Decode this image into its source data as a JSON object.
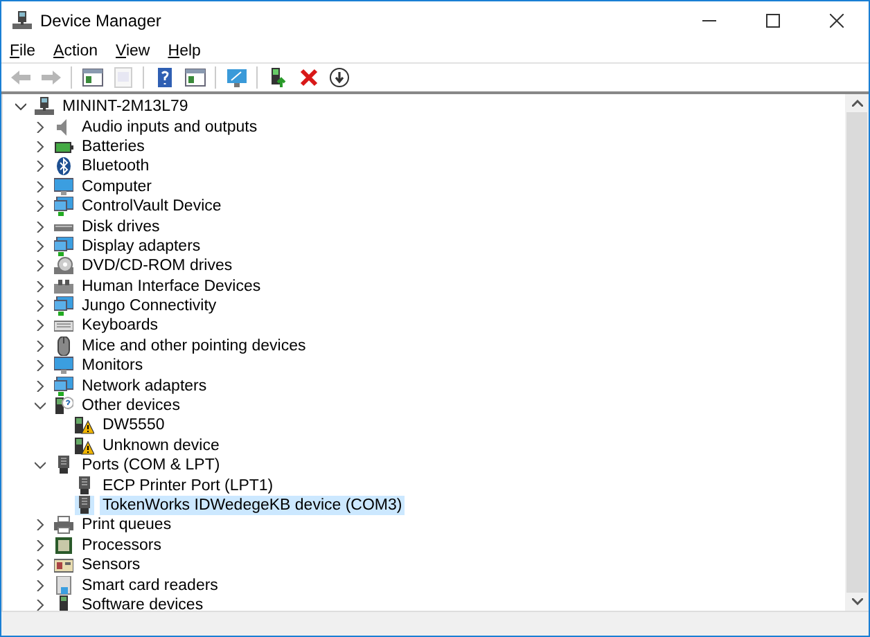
{
  "window": {
    "title": "Device Manager"
  },
  "menu": [
    "File",
    "Action",
    "View",
    "Help"
  ],
  "toolbar": [
    {
      "disabled": true
    },
    {
      "disabled": true
    },
    {
      "disabled": false
    },
    {
      "disabled": true
    },
    {
      "disabled": false
    },
    {
      "disabled": false
    },
    {
      "disabled": false
    },
    {
      "disabled": false
    },
    {
      "disabled": false
    },
    {
      "disabled": false
    }
  ],
  "tree": {
    "label": "MININT-2M13L79",
    "expanded": true,
    "selected": false,
    "children": [
      {
        "label": "Audio inputs and outputs",
        "expanded": false,
        "selected": false
      },
      {
        "label": "Batteries",
        "expanded": false,
        "selected": false
      },
      {
        "label": "Bluetooth",
        "expanded": false,
        "selected": false
      },
      {
        "label": "Computer",
        "expanded": false,
        "selected": false
      },
      {
        "label": "ControlVault Device",
        "expanded": false,
        "selected": false
      },
      {
        "label": "Disk drives",
        "expanded": false,
        "selected": false
      },
      {
        "label": "Display adapters",
        "expanded": false,
        "selected": false
      },
      {
        "label": "DVD/CD-ROM drives",
        "expanded": false,
        "selected": false
      },
      {
        "label": "Human Interface Devices",
        "expanded": false,
        "selected": false
      },
      {
        "label": "Jungo Connectivity",
        "expanded": false,
        "selected": false
      },
      {
        "label": "Keyboards",
        "expanded": false,
        "selected": false
      },
      {
        "label": "Mice and other pointing devices",
        "expanded": false,
        "selected": false
      },
      {
        "label": "Monitors",
        "expanded": false,
        "selected": false
      },
      {
        "label": "Network adapters",
        "expanded": false,
        "selected": false
      },
      {
        "label": "Other devices",
        "expanded": true,
        "selected": false,
        "children": [
          {
            "label": "DW5550",
            "selected": false
          },
          {
            "label": "Unknown device",
            "selected": false
          }
        ]
      },
      {
        "label": "Ports (COM & LPT)",
        "expanded": true,
        "selected": false,
        "children": [
          {
            "label": "ECP Printer Port (LPT1)",
            "selected": false
          },
          {
            "label": "TokenWorks IDWedegeKB device (COM3)",
            "selected": true
          }
        ]
      },
      {
        "label": "Print queues",
        "expanded": false,
        "selected": false
      },
      {
        "label": "Processors",
        "expanded": false,
        "selected": false
      },
      {
        "label": "Sensors",
        "expanded": false,
        "selected": false
      },
      {
        "label": "Smart card readers",
        "expanded": false,
        "selected": false
      },
      {
        "label": "Software devices",
        "expanded": false,
        "selected": false
      }
    ]
  }
}
